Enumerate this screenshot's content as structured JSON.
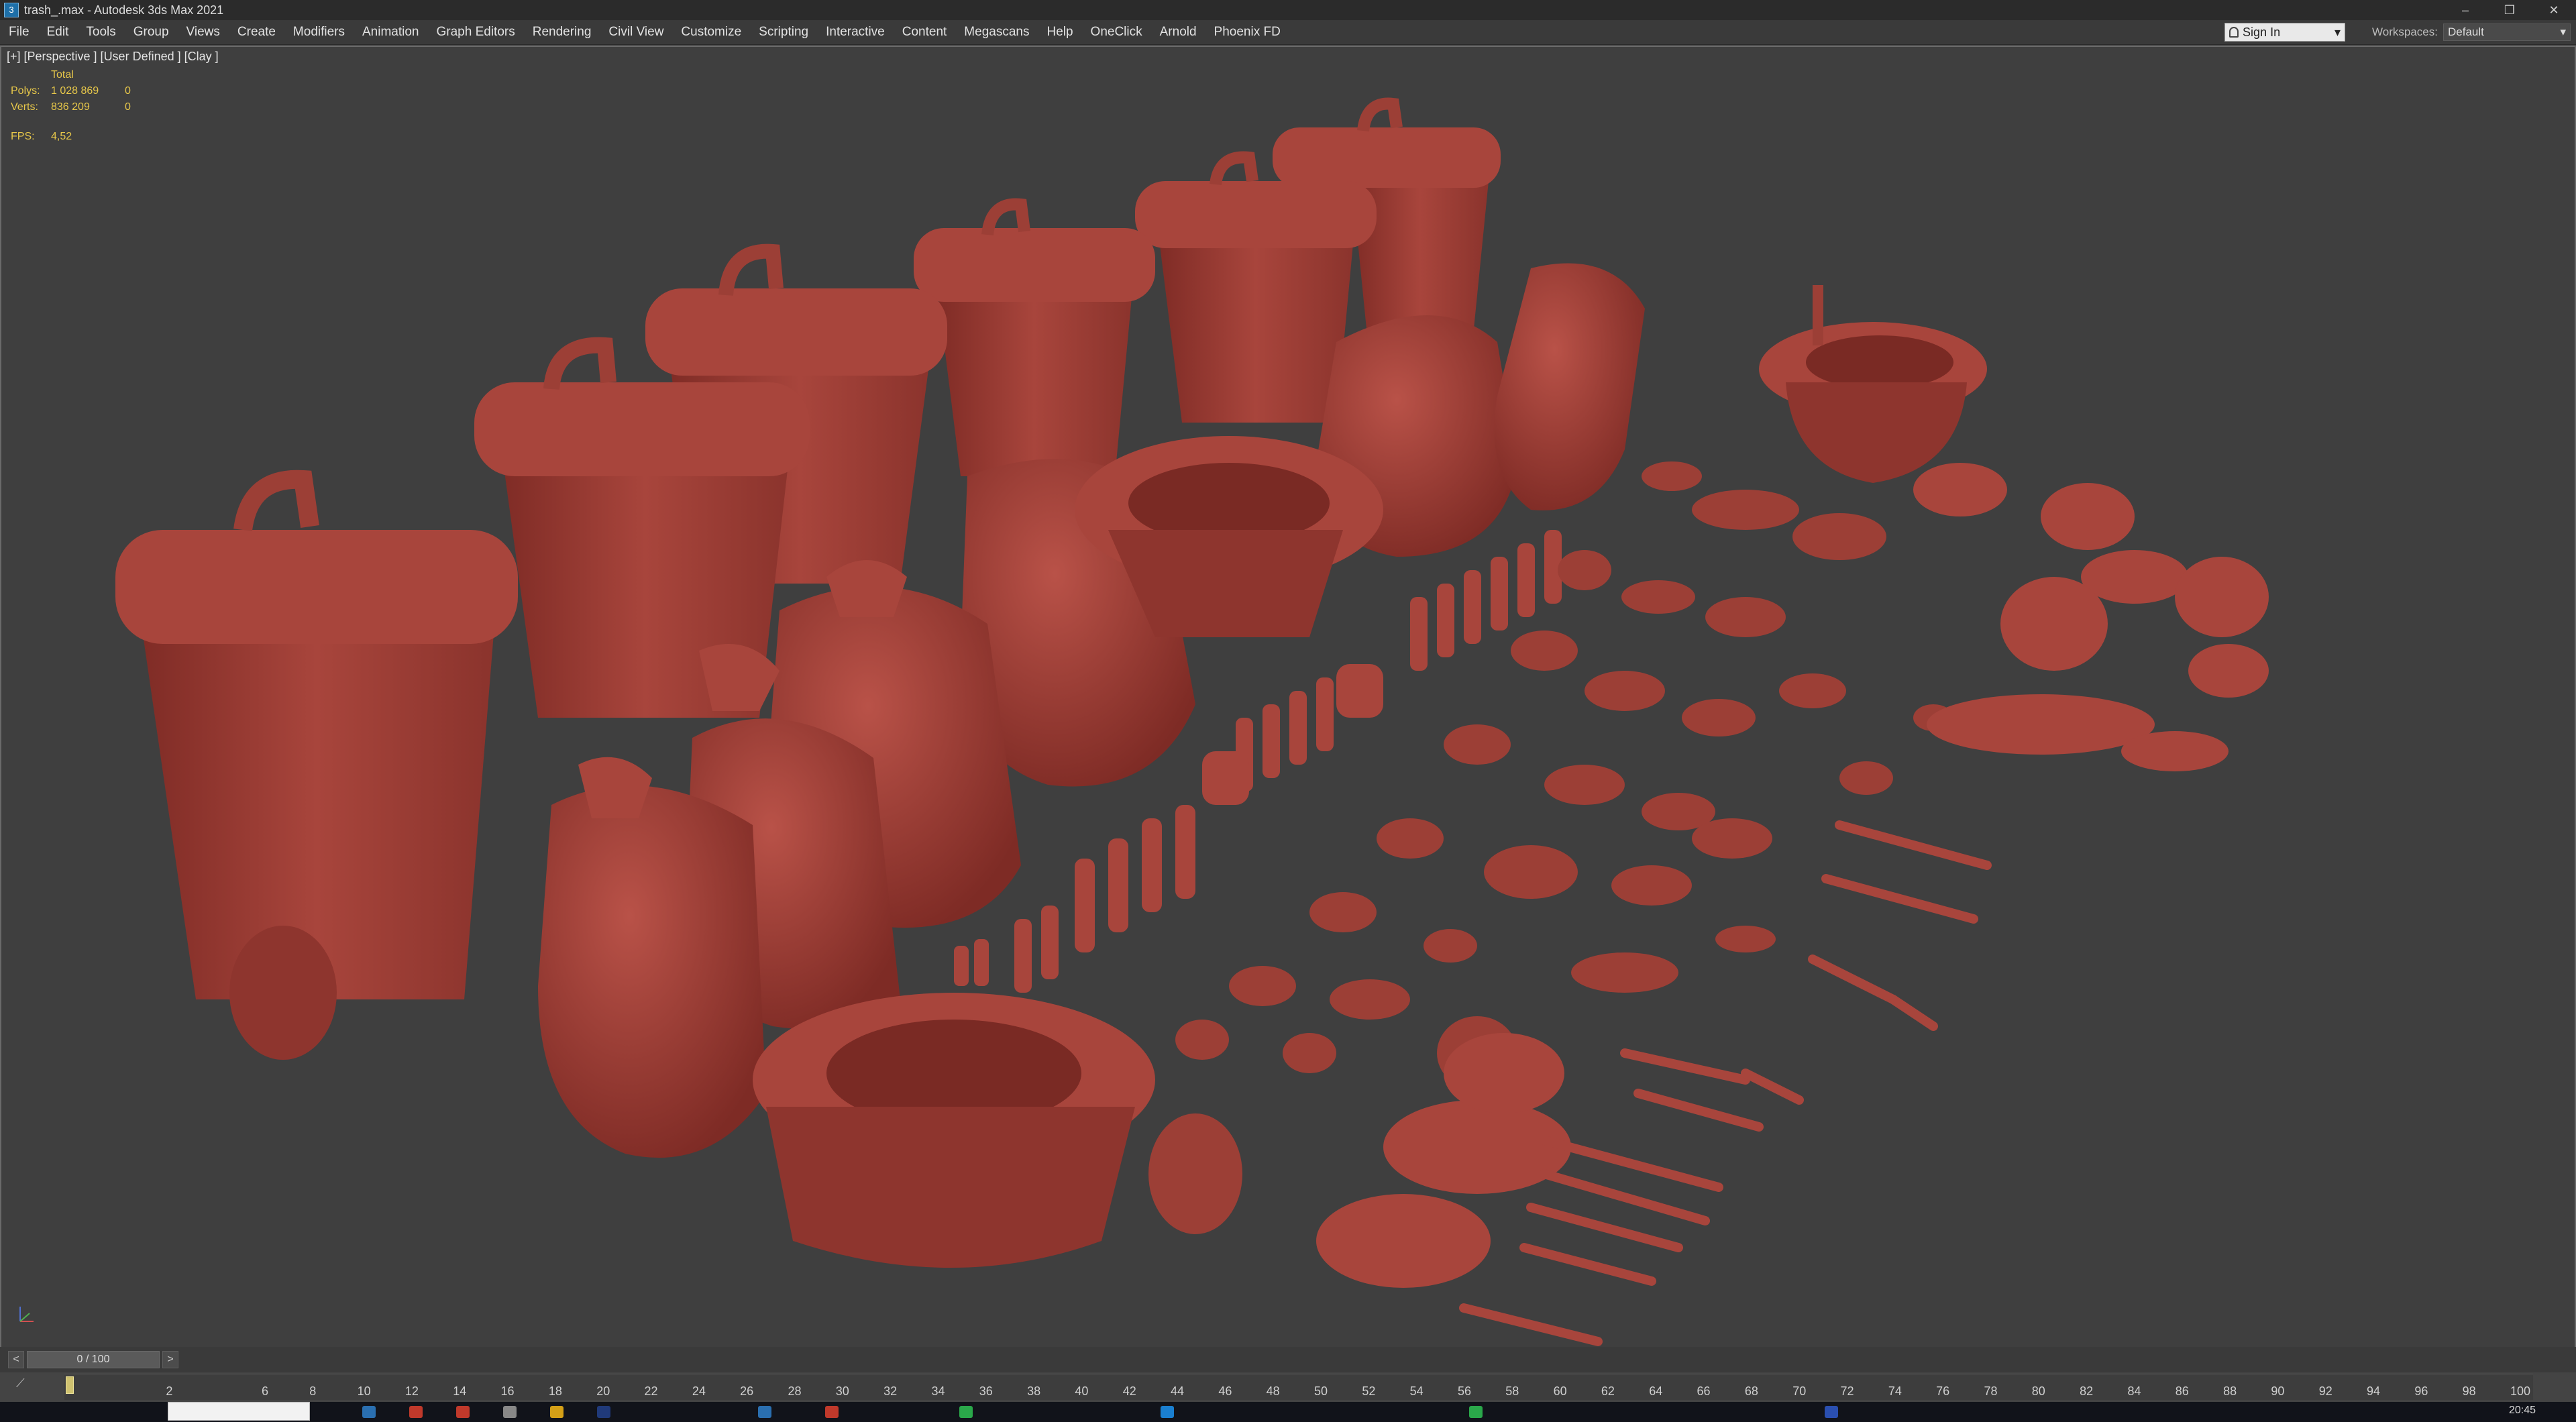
{
  "window": {
    "icon_glyph": "3",
    "title": "trash_.max - Autodesk 3ds Max 2021",
    "minimize": "–",
    "restore": "❐",
    "close": "✕"
  },
  "menu": {
    "items": [
      "File",
      "Edit",
      "Tools",
      "Group",
      "Views",
      "Create",
      "Modifiers",
      "Animation",
      "Graph Editors",
      "Rendering",
      "Civil View",
      "Customize",
      "Scripting",
      "Interactive",
      "Content",
      "Megascans",
      "Help",
      "OneClick",
      "Arnold",
      "Phoenix FD"
    ],
    "signin_label": "Sign In",
    "signin_arrow": "▾",
    "workspaces_label": "Workspaces:",
    "workspace_value": "Default",
    "workspace_arrow": "▾"
  },
  "viewport": {
    "label": "[+] [Perspective ] [User Defined ] [Clay ]",
    "stats_header": "Total",
    "polys_label": "Polys:",
    "polys_total": "1 028 869",
    "polys_selected": "0",
    "verts_label": "Verts:",
    "verts_total": "836 209",
    "verts_selected": "0",
    "fps_label": "FPS:",
    "fps_value": "4,52",
    "clay_color": "#a8453c"
  },
  "timeline": {
    "prev": "<",
    "frame": "0 / 100",
    "next": ">",
    "ticks": [
      "2",
      "6",
      "8",
      "10",
      "12",
      "14",
      "16",
      "18",
      "20",
      "22",
      "24",
      "26",
      "28",
      "30",
      "32",
      "34",
      "36",
      "38",
      "40",
      "42",
      "44",
      "46",
      "48",
      "50",
      "52",
      "54",
      "56",
      "58",
      "60",
      "62",
      "64",
      "66",
      "68",
      "70",
      "72",
      "74",
      "76",
      "78",
      "80",
      "82",
      "84",
      "86",
      "88",
      "90",
      "92",
      "94",
      "96",
      "98",
      "100"
    ]
  },
  "taskbar": {
    "clock": "20:45"
  }
}
